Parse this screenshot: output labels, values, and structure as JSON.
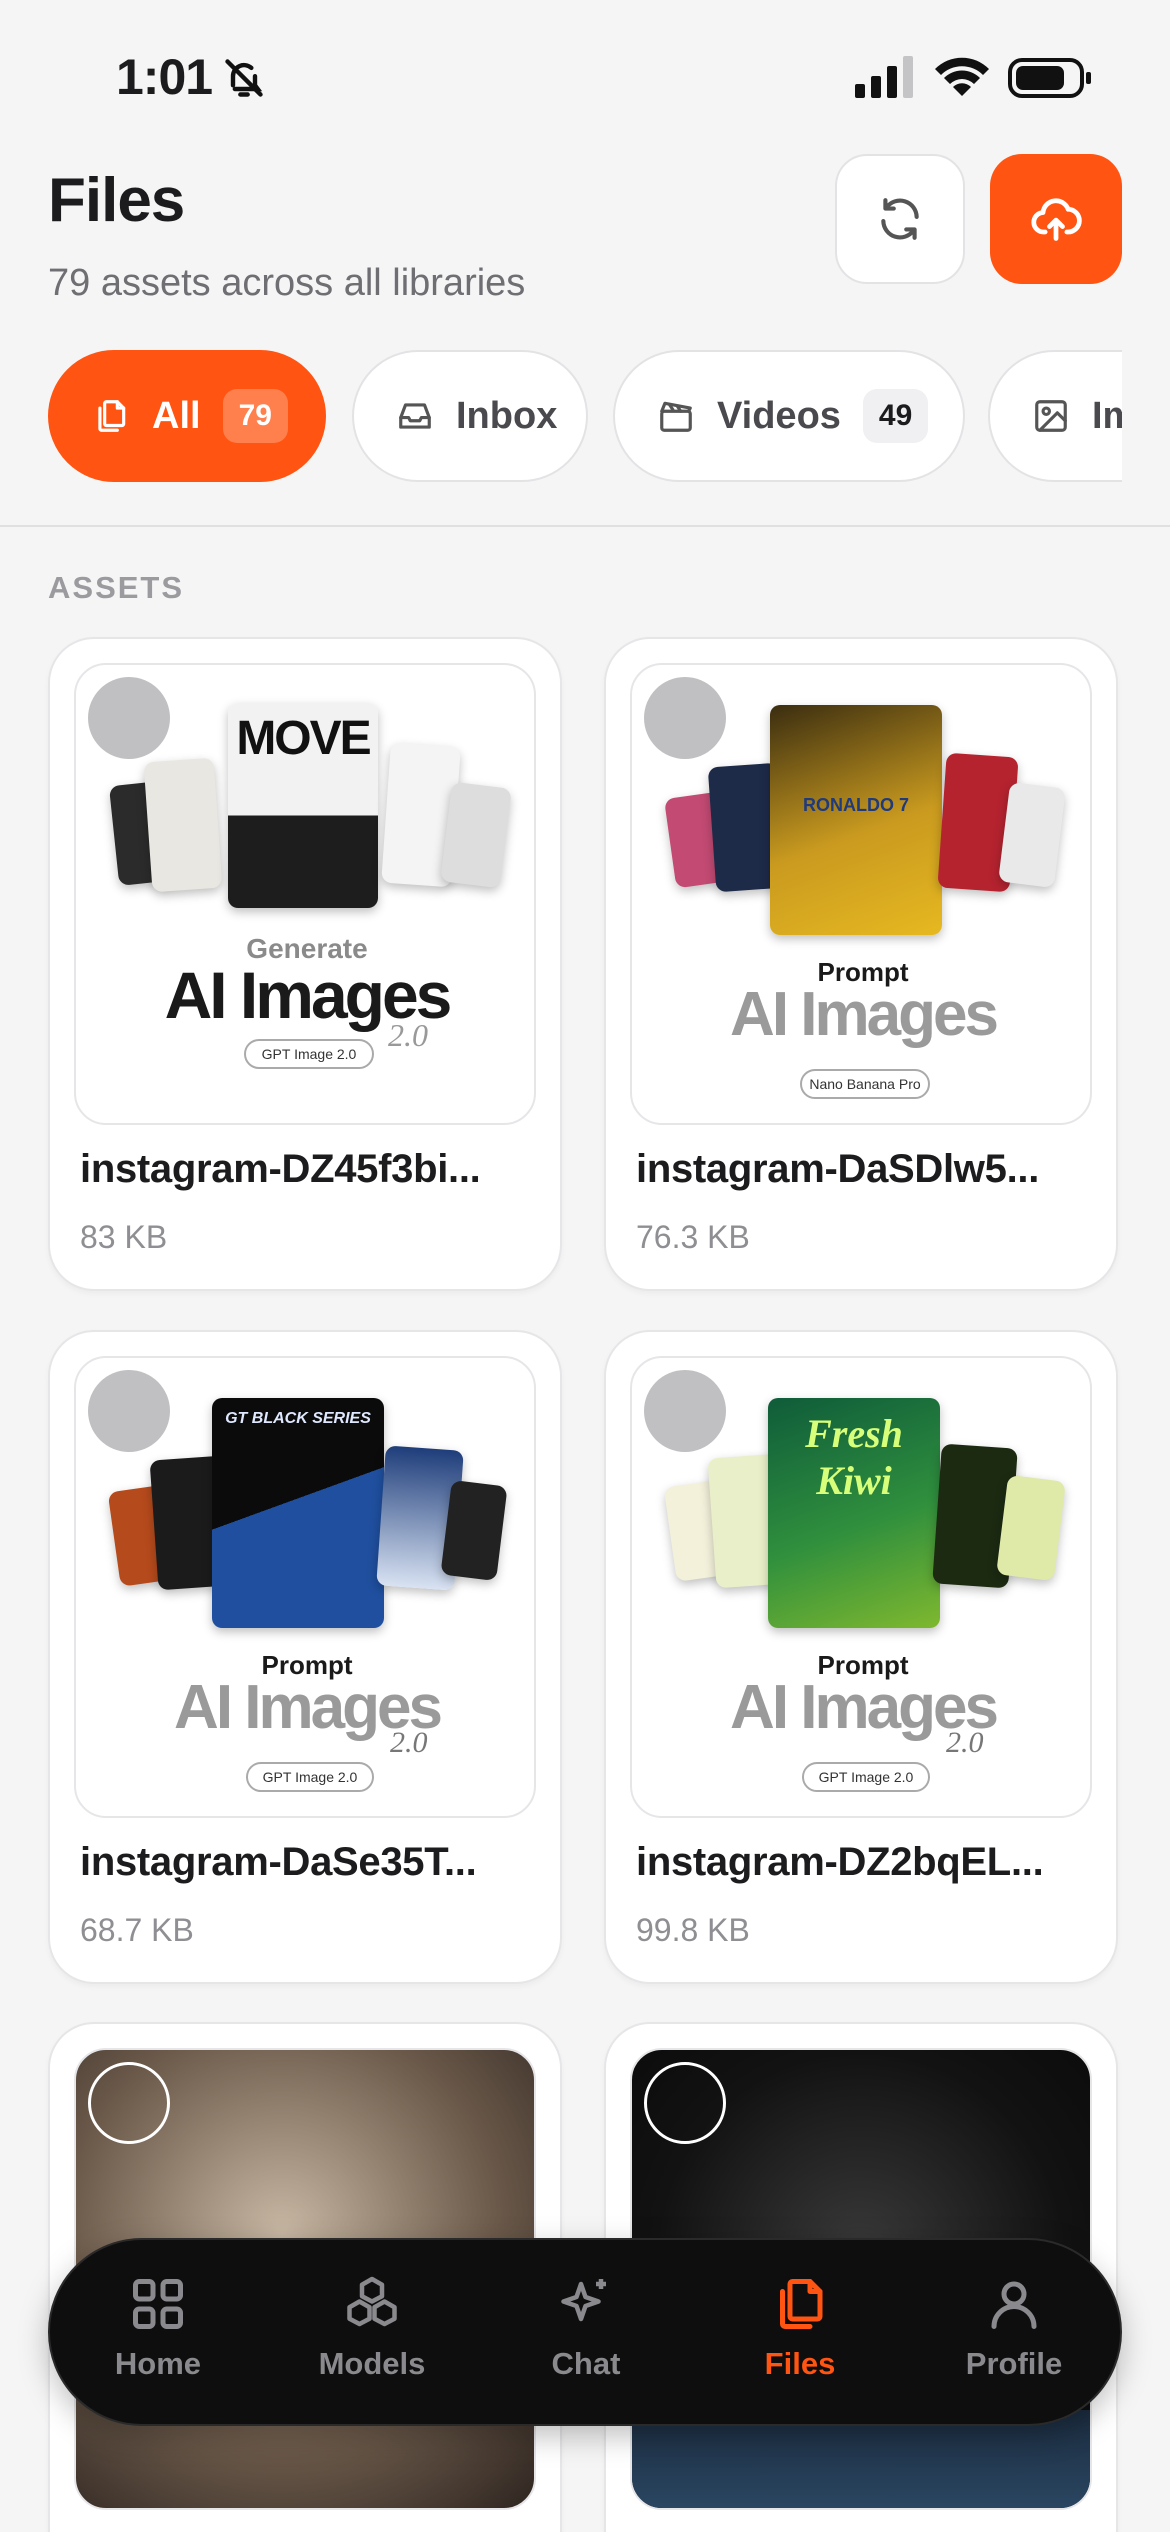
{
  "status": {
    "time": "1:01"
  },
  "header": {
    "title": "Files",
    "subtitle": "79 assets across all libraries"
  },
  "filters": [
    {
      "label": "All",
      "count": "79",
      "active": true,
      "icon": "copy-icon"
    },
    {
      "label": "Inbox",
      "count": "",
      "active": false,
      "icon": "inbox-icon"
    },
    {
      "label": "Videos",
      "count": "49",
      "active": false,
      "icon": "clapperboard-icon"
    },
    {
      "label": "Im",
      "count": "",
      "active": false,
      "icon": "image-icon"
    }
  ],
  "section_label": "ASSETS",
  "assets": [
    {
      "name": "instagram-DZ45f3bi...",
      "size": "83 KB",
      "promo_top": "Generate",
      "promo_main": "AI Images",
      "promo_ver": "2.0",
      "promo_pill": "GPT Image 2.0",
      "cover_text": "MOVE"
    },
    {
      "name": "instagram-DaSDlw5...",
      "size": "76.3 KB",
      "promo_top": "Prompt",
      "promo_main": "AI Images",
      "promo_ver": "",
      "promo_pill": "Nano Banana Pro",
      "cover_text": "RONALDO 7"
    },
    {
      "name": "instagram-DaSe35T...",
      "size": "68.7 KB",
      "promo_top": "Prompt",
      "promo_main": "AI Images",
      "promo_ver": "2.0",
      "promo_pill": "GPT Image 2.0",
      "cover_text": "GT BLACK SERIES"
    },
    {
      "name": "instagram-DZ2bqEL...",
      "size": "99.8 KB",
      "promo_top": "Prompt",
      "promo_main": "AI Images",
      "promo_ver": "2.0",
      "promo_pill": "GPT Image 2.0",
      "cover_text": "Fresh Kiwi"
    },
    {
      "name": "",
      "size": ""
    },
    {
      "name": "",
      "size": ""
    }
  ],
  "tabbar": [
    {
      "label": "Home",
      "icon": "grid-icon",
      "active": false
    },
    {
      "label": "Models",
      "icon": "cubes-icon",
      "active": false
    },
    {
      "label": "Chat",
      "icon": "sparkle-icon",
      "active": false
    },
    {
      "label": "Files",
      "icon": "files-icon",
      "active": true
    },
    {
      "label": "Profile",
      "icon": "user-icon",
      "active": false
    }
  ],
  "colors": {
    "accent": "#ff5412",
    "background": "#f5f5f5",
    "tabbar": "#0e0e0e"
  }
}
